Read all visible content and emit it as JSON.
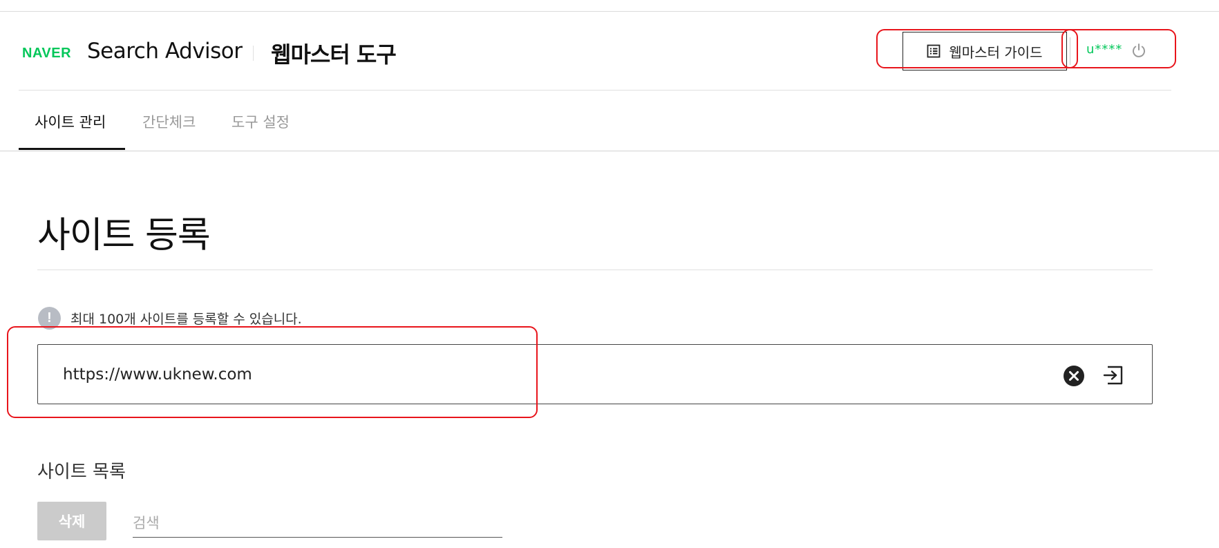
{
  "header": {
    "logo": "NAVER",
    "title": "Search Advisor",
    "subtitle": "웹마스터 도구",
    "guide_button": "웹마스터 가이드",
    "username": "u****"
  },
  "tabs": [
    {
      "label": "사이트 관리",
      "active": true
    },
    {
      "label": "간단체크",
      "active": false
    },
    {
      "label": "도구 설정",
      "active": false
    }
  ],
  "main": {
    "page_title": "사이트 등록",
    "notice": "최대 100개 사이트를 등록할 수 있습니다.",
    "url_input_value": "https://www.uknew.com",
    "list_title": "사이트 목록",
    "delete_button": "삭제",
    "search_placeholder": "검색"
  },
  "colors": {
    "naver_green": "#03c75a",
    "annotation_red": "#e8141b",
    "disabled_gray": "#cbcbcb"
  },
  "icons": [
    "guide-list-icon",
    "power-icon",
    "info-icon",
    "clear-icon",
    "submit-arrow-icon"
  ]
}
